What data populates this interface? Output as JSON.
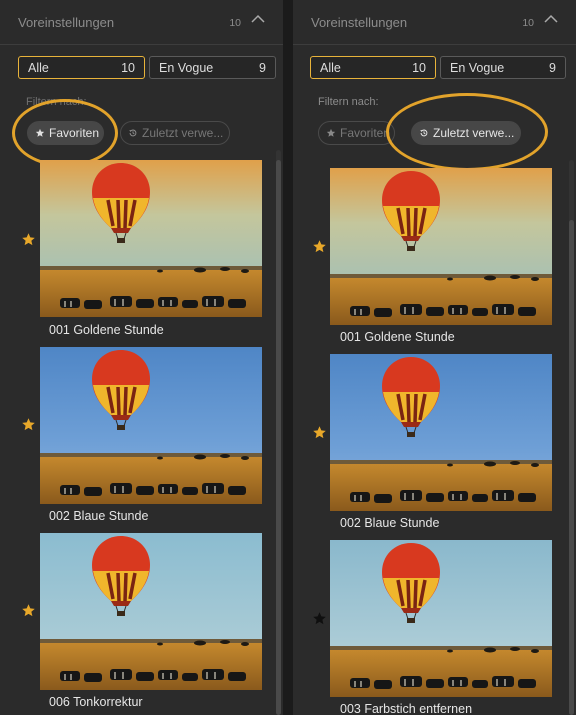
{
  "colors": {
    "accent": "#e8b33a",
    "highlight_ring": "#e2a32b",
    "panel_bg": "#2b2b2b",
    "star_favorite": "#e8a82a",
    "star_unset": "#0f0f0f"
  },
  "panels": [
    {
      "header": {
        "title": "Voreinstellungen",
        "count": "10"
      },
      "tabs": [
        {
          "label": "Alle",
          "count": "10",
          "selected": true
        },
        {
          "label": "En Vogue",
          "count": "9",
          "selected": false
        }
      ],
      "filter_label": "Filtern nach:",
      "chips": [
        {
          "label": "Favoriten",
          "icon": "star-icon",
          "active": true
        },
        {
          "label": "Zuletzt verwe...",
          "icon": "recent-icon",
          "active": false
        }
      ],
      "items": [
        {
          "label": "001 Goldene Stunde",
          "favorite": true,
          "icon": "star-icon"
        },
        {
          "label": "002 Blaue Stunde",
          "favorite": true,
          "icon": "star-icon"
        },
        {
          "label": "006 Tonkorrektur",
          "favorite": true,
          "icon": "star-icon"
        }
      ]
    },
    {
      "header": {
        "title": "Voreinstellungen",
        "count": "10"
      },
      "tabs": [
        {
          "label": "Alle",
          "count": "10",
          "selected": true
        },
        {
          "label": "En Vogue",
          "count": "9",
          "selected": false
        }
      ],
      "filter_label": "Filtern nach:",
      "chips": [
        {
          "label": "Favoriten",
          "icon": "star-icon",
          "active": false
        },
        {
          "label": "Zuletzt verwe...",
          "icon": "recent-icon",
          "active": true
        }
      ],
      "items": [
        {
          "label": "001 Goldene Stunde",
          "favorite": true,
          "icon": "star-icon"
        },
        {
          "label": "002 Blaue Stunde",
          "favorite": true,
          "icon": "star-icon"
        },
        {
          "label": "003 Farbstich entfernen",
          "favorite": false,
          "icon": "star-icon"
        }
      ]
    }
  ]
}
